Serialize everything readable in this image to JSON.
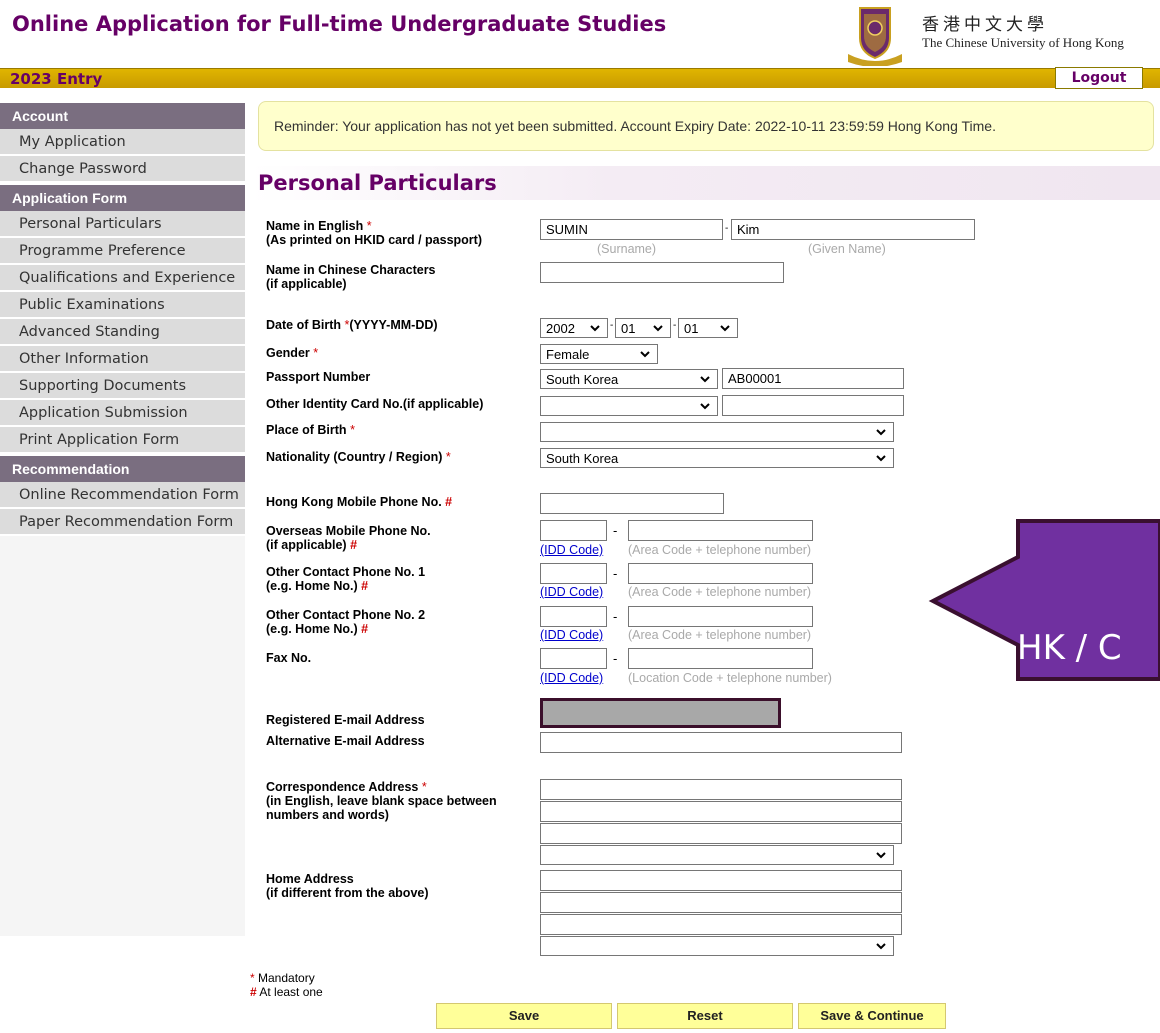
{
  "header": {
    "title": "Online Application for Full-time Undergraduate Studies",
    "university_cn": "香港中文大學",
    "university_en": "The Chinese University of Hong Kong",
    "entry": "2023 Entry",
    "logout_label": "Logout"
  },
  "sidebar": {
    "account_heading": "Account",
    "account_items": [
      "My Application",
      "Change Password"
    ],
    "form_heading": "Application Form",
    "form_items": [
      "Personal Particulars",
      "Programme Preference",
      "Qualifications and Experience",
      "Public Examinations",
      "Advanced Standing",
      "Other Information",
      "Supporting Documents",
      "Application Submission",
      "Print Application Form"
    ],
    "rec_heading": "Recommendation",
    "rec_items": [
      "Online Recommendation Form",
      "Paper Recommendation Form"
    ]
  },
  "reminder": "Reminder: Your application has not yet been submitted. Account Expiry Date: 2022-10-11 23:59:59 Hong Kong Time.",
  "section_title": "Personal Particulars",
  "form": {
    "name_en_label": "Name in English",
    "name_en_sub": "(As printed on HKID card / passport)",
    "surname_value": "SUMIN",
    "given_value": "Kim",
    "surname_hint": "(Surname)",
    "given_hint": "(Given Name)",
    "name_cn_label": "Name in Chinese Characters",
    "name_cn_sub": "(if applicable)",
    "dob_label": "Date of Birth",
    "dob_format": "(YYYY-MM-DD)",
    "dob_year": "2002",
    "dob_month": "01",
    "dob_day": "01",
    "gender_label": "Gender",
    "gender_value": "Female",
    "passport_label": "Passport Number",
    "passport_country": "South Korea",
    "passport_number": "AB00001",
    "other_id_label": "Other Identity Card No.(if applicable)",
    "birth_place_label": "Place of Birth",
    "nationality_label": "Nationality (Country / Region)",
    "nationality_value": "South Korea",
    "hk_mobile_label": "Hong Kong Mobile Phone No.",
    "overseas_label": "Overseas Mobile Phone No.",
    "overseas_sub": "(if applicable)",
    "other1_label": "Other Contact Phone No. 1",
    "other2_label": "Other Contact Phone No. 2",
    "home_no_sub": "(e.g. Home No.)",
    "fax_label": "Fax No.",
    "idd_link": "(IDD Code)",
    "area_hint": "(Area Code + telephone number)",
    "location_hint": "(Location Code + telephone number)",
    "reg_email_label": "Registered E-mail Address",
    "alt_email_label": "Alternative E-mail Address",
    "corr_addr_label": "Correspondence Address",
    "corr_addr_sub1": "(in English, leave blank space between",
    "corr_addr_sub2": "numbers and words)",
    "home_addr_label": "Home Address",
    "home_addr_sub": "(if different from the above)",
    "dash": "-",
    "req_mark": "*",
    "hash_mark": "#"
  },
  "legend": {
    "mandatory": "Mandatory",
    "at_least_one": "At least one"
  },
  "buttons": {
    "save": "Save",
    "reset": "Reset",
    "save_continue": "Save & Continue"
  },
  "annotation": {
    "text": "HK / C",
    "color": "#7030a0"
  }
}
